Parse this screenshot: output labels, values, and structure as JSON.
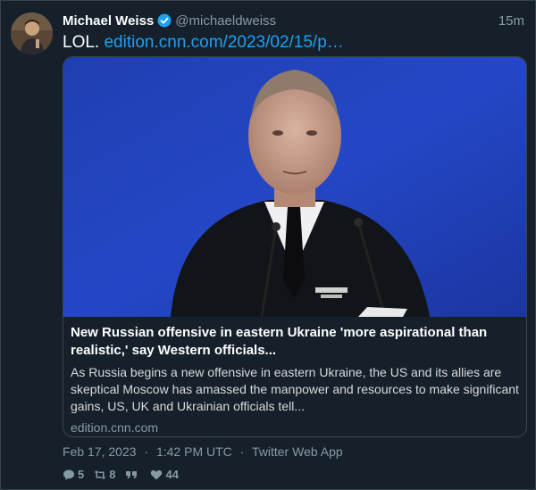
{
  "author": {
    "display_name": "Michael Weiss",
    "handle": "@michaeldweiss",
    "verified": true
  },
  "tweet": {
    "time_ago": "15m",
    "text": "LOL.",
    "link_text": "edition.cnn.com/2023/02/15/p…"
  },
  "card": {
    "title": "New Russian offensive in eastern Ukraine 'more aspirational than realistic,' say Western officials...",
    "description": "As Russia begins a new offensive in eastern Ukraine, the US and its allies are skeptical Moscow has amassed the manpower and resources to make significant gains, US, UK and Ukrainian officials tell...",
    "domain": "edition.cnn.com"
  },
  "meta": {
    "date": "Feb 17, 2023",
    "time": "1:42 PM UTC",
    "client": "Twitter Web App",
    "separator": "·"
  },
  "actions": {
    "replies": "5",
    "retweets": "8",
    "likes": "44"
  },
  "colors": {
    "background": "#15202b",
    "accent": "#1da1f2",
    "muted": "#8899a6",
    "border": "#38444d"
  },
  "icons": [
    "verified-badge-icon",
    "reply-icon",
    "retweet-icon",
    "quote-icon",
    "like-icon"
  ]
}
